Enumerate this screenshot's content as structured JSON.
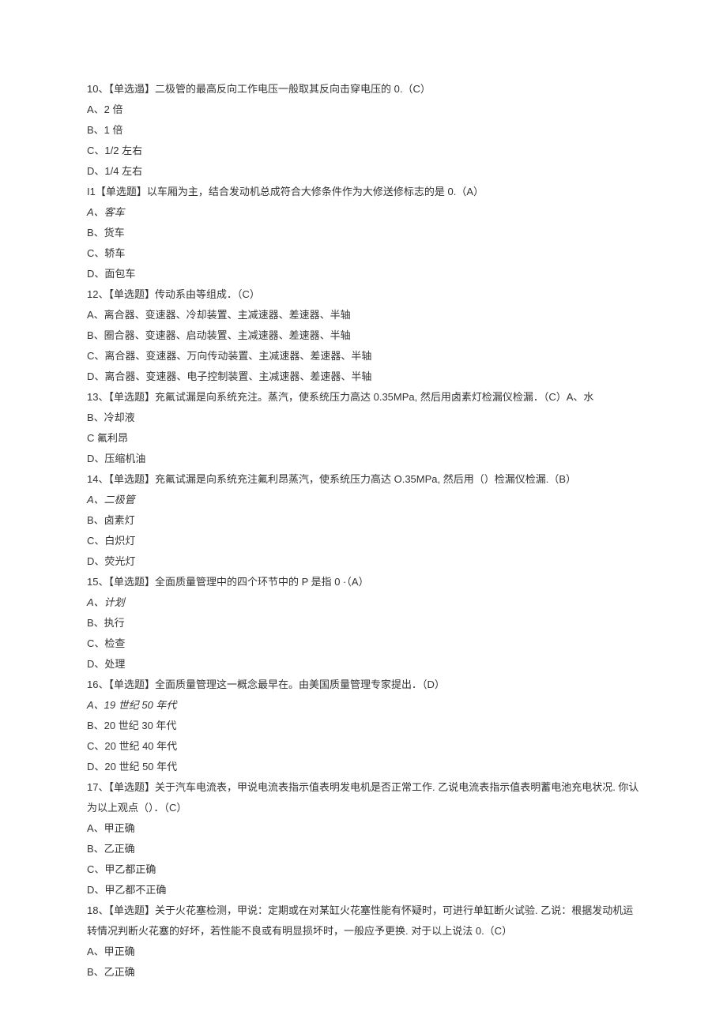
{
  "questions": [
    {
      "num": "10、",
      "type": "【单选遢】",
      "text": "二极管的最高反向工作电压一般取其反向击穿电压的 0.（C）",
      "options": [
        "A、2 倍",
        "B、1 倍",
        "C、1/2 左右",
        "D、1/4 左右"
      ]
    },
    {
      "num": "I1",
      "type": "【单选题】",
      "text": "以车厢为主，结合发动机总成符合大修条件作为大修送修标志的是 0.（A）",
      "options": [
        "A、客车",
        "B、货车",
        "C、轿车",
        "D、面包车"
      ]
    },
    {
      "num": "12、",
      "type": "【单选题】",
      "text": "传动系由等组成．（C）",
      "options": [
        "A、离合器、变速器、冷却装置、主减速器、差速器、半轴",
        "B、圈合器、变速器、启动装置、主减速器、差速器、半轴",
        "C、离合器、变速器、万向传动装置、主减速器、差速器、半轴",
        "D、离合器、变速器、电子控制装置、主减速器、差速器、半轴"
      ]
    },
    {
      "num": "13、",
      "type": "【单选题】",
      "text": "充氟试漏是向系统充注。蒸汽，使系统压力高达 0.35MPa, 然后用卤素灯检漏仪检漏．（C）A、水",
      "options": [
        "B、冷却液",
        "C 氟利昂",
        "D、压缩机油"
      ]
    },
    {
      "num": "14、",
      "type": "【单选题】",
      "text": "充氟试漏是向系统充注氟利昂蒸汽，使系统压力高达 O.35MPa, 然后用（）检漏仪检漏.（B）",
      "options": [
        "A、二极管",
        "B、卤素灯",
        "C、白炽灯",
        "D、荧光灯"
      ]
    },
    {
      "num": "15、",
      "type": "【单选题】",
      "text": "全面质量管理中的四个环节中的 P 是指 0 ·（A）",
      "options": [
        "A、计划",
        "B、执行",
        "C、检查",
        "D、处理"
      ]
    },
    {
      "num": "16、",
      "type": "【单选题】",
      "text": "全面质量管理这一概念最早在。由美国质量管理专家提出．（D）",
      "options": [
        "A、19 世纪 50 年代",
        "B、20 世纪 30 年代",
        "C、20 世纪 40 年代",
        "D、20 世纪 50 年代"
      ]
    },
    {
      "num": "17、",
      "type": "【单选题】",
      "text": "关于汽车电流表，甲说电流表指示值表明发电机是否正常工作. 乙说电流表指示值表明蓄电池充电状况. 你认为以上观点（）．（C）",
      "options": [
        "A、甲正确",
        "B、乙正确",
        "C、甲乙都正确",
        "D、甲乙都不正确"
      ]
    },
    {
      "num": "18、",
      "type": "【单选题】",
      "text": "关于火花塞检测，甲说：定期或在对某缸火花塞性能有怀疑时，可进行单缸断火试验. 乙说：根据发动机运转情况判断火花塞的好坏，若性能不良或有明显损坏时，一般应予更换. 对于以上说法 0.（C）",
      "options": [
        "A、甲正确",
        "B、乙正确"
      ]
    }
  ]
}
